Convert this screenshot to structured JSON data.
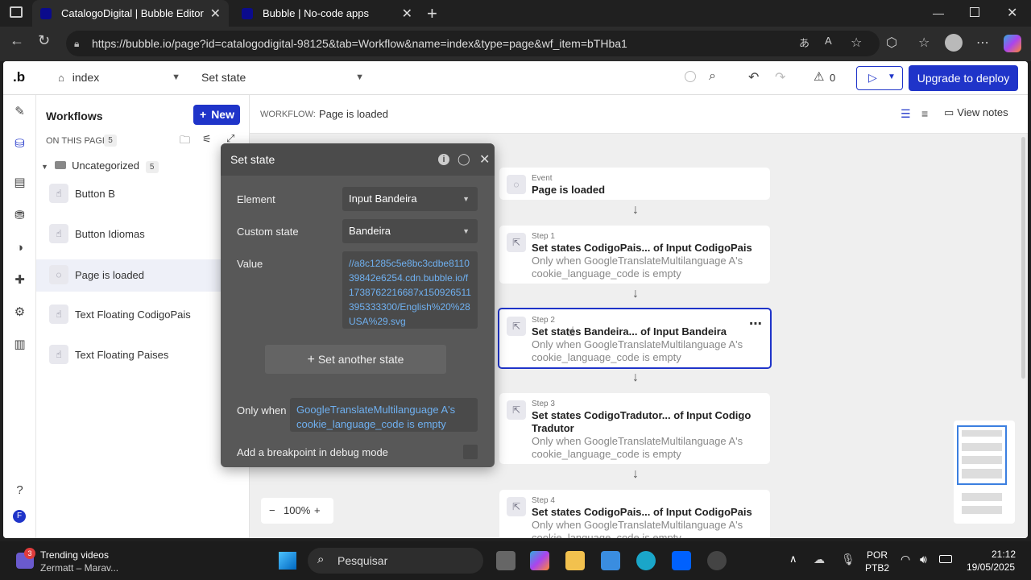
{
  "browser": {
    "tabs": [
      {
        "title": "CatalogoDigital | Bubble Editor",
        "active": true
      },
      {
        "title": "Bubble | No-code apps",
        "active": false
      }
    ],
    "url": "https://bubble.io/page?id=catalogodigital-98125&tab=Workflow&name=index&type=page&wf_item=bTHba1"
  },
  "topbar": {
    "logo": ".b",
    "page_select": "index",
    "element_select": "Set state",
    "issues_count": "0",
    "upgrade_label": "Upgrade to deploy"
  },
  "workflows": {
    "title": "Workflows",
    "new_label": "New",
    "on_this_page": "ON THIS PAGE",
    "on_this_page_count": "5",
    "folder": "Uncategorized",
    "folder_count": "5",
    "items": [
      {
        "label": "Button B"
      },
      {
        "label": "Button Idiomas"
      },
      {
        "label": "Page is loaded"
      },
      {
        "label": "Text Floating CodigoPais"
      },
      {
        "label": "Text Floating Paises"
      }
    ]
  },
  "header": {
    "workflow_label": "WORKFLOW:",
    "workflow_name": "Page is loaded",
    "view_notes": "View notes"
  },
  "popup": {
    "title": "Set state",
    "element_label": "Element",
    "element_value": "Input Bandeira",
    "custom_state_label": "Custom state",
    "custom_state_value": "Bandeira",
    "value_label": "Value",
    "value_text": "//a8c1285c5e8bc3cdbe811039842e6254.cdn.bubble.io/f1738762216687x150926511395333300/English%20%28USA%29.svg",
    "set_another": "Set another state",
    "only_when_label": "Only when",
    "only_when_value": "GoogleTranslateMultilanguage A's cookie_language_code is empty",
    "breakpoint_label": "Add a breakpoint in debug mode"
  },
  "steps": [
    {
      "step": "Event",
      "title": "Page is loaded",
      "cond": ""
    },
    {
      "step": "Step 1",
      "title": "Set states CodigoPais... of Input CodigoPais",
      "cond": "Only when GoogleTranslateMultilanguage A's cookie_language_code is empty"
    },
    {
      "step": "Step 2",
      "title": "Set states Bandeira... of Input Bandeira",
      "cond": "Only when GoogleTranslateMultilanguage A's cookie_language_code is empty"
    },
    {
      "step": "Step 3",
      "title": "Set states CodigoTradutor... of Input Codigo Tradutor",
      "cond": "Only when GoogleTranslateMultilanguage A's cookie_language_code is empty"
    },
    {
      "step": "Step 4",
      "title": "Set states CodigoPais... of Input CodigoPais",
      "cond": "Only when GoogleTranslateMultilanguage A's cookie_language_code is empty"
    }
  ],
  "zoom": {
    "value": "100%"
  },
  "taskbar": {
    "news_badge": "3",
    "news_title": "Trending videos",
    "news_sub": "Zermatt – Marav...",
    "search_placeholder": "Pesquisar",
    "lang_1": "POR",
    "lang_2": "PTB2",
    "time": "21:12",
    "date": "19/05/2025"
  },
  "colors": {
    "accent": "#1f34c9",
    "selected_border": "#1f34c9"
  }
}
